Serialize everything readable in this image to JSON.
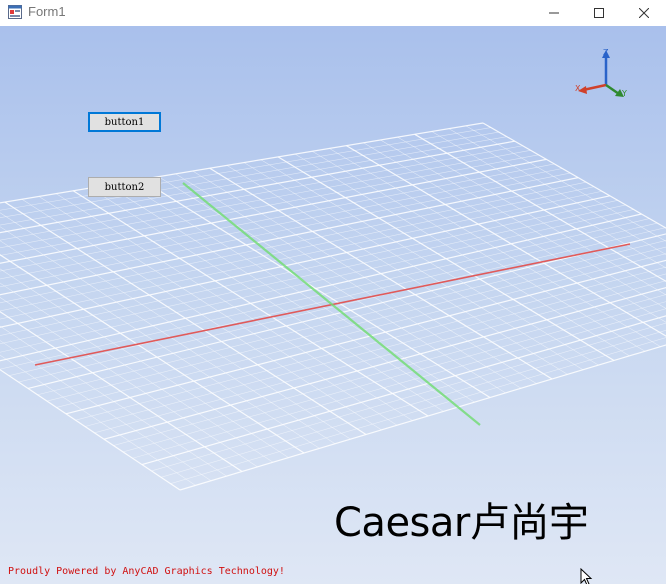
{
  "window": {
    "title": "Form1",
    "app_icon": "winforms-app-icon",
    "controls": {
      "minimize": "minimize-icon",
      "maximize": "maximize-icon",
      "close": "close-icon"
    }
  },
  "buttons": {
    "button1": "button1",
    "button2": "button2"
  },
  "viewport": {
    "axes_labels": {
      "z": "Z",
      "x": "X",
      "y": "Y"
    },
    "overlay_text": "Caesar卢尚宇",
    "footer_text": "Proudly Powered by AnyCAD Graphics Technology!",
    "colors": {
      "background_top": "#a9c0ec",
      "background_bottom": "#dfe7f5",
      "grid": "#ffffff",
      "x_axis": "#e05a5a",
      "y_axis": "#6fdc6f",
      "z_axis": "#2a63c9",
      "footer": "#d01010"
    }
  }
}
